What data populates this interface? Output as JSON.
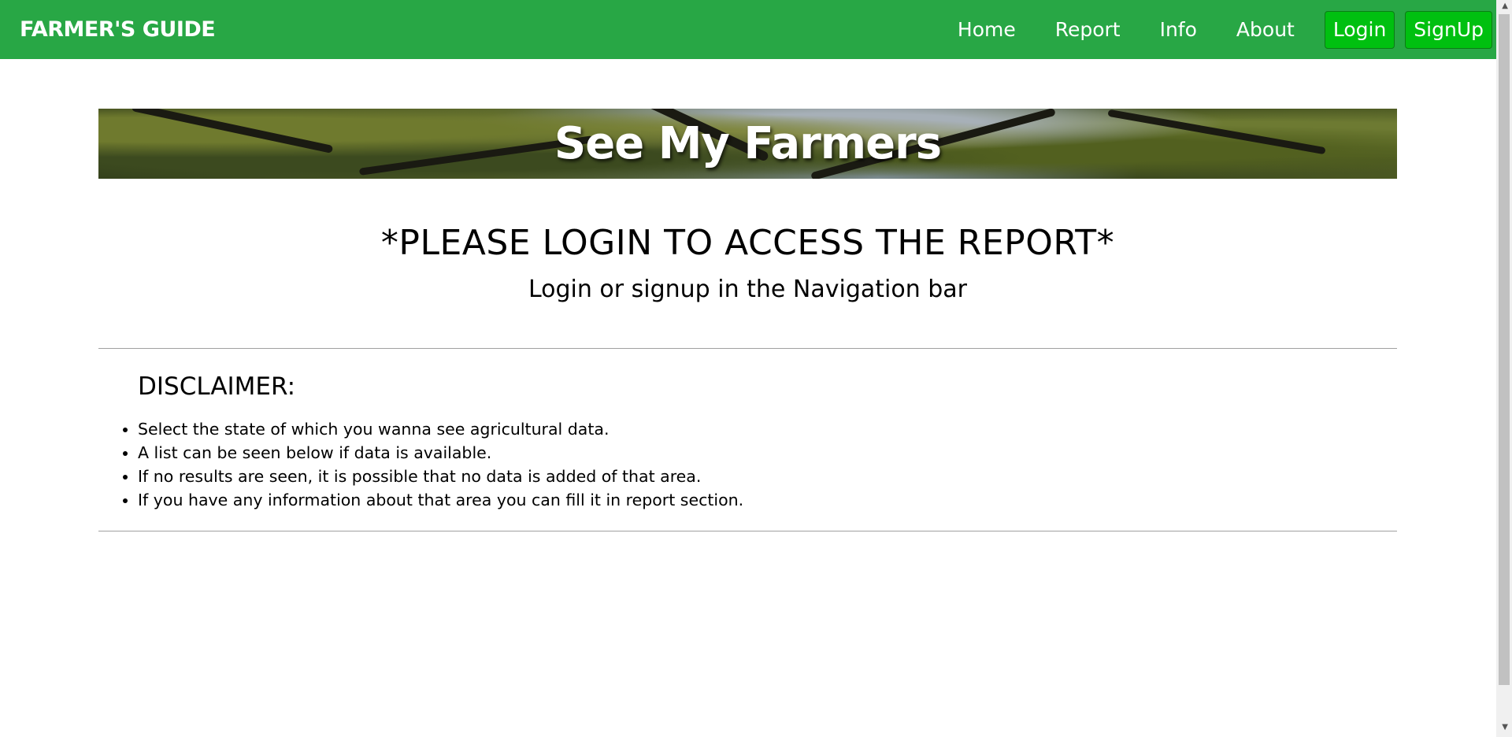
{
  "navbar": {
    "brand": "FARMER'S GUIDE",
    "links": [
      "Home",
      "Report",
      "Info",
      "About"
    ],
    "login_label": "Login",
    "signup_label": "SignUp",
    "background": "#28a745",
    "button_color": "#00c010"
  },
  "banner": {
    "title": "See My Farmers"
  },
  "main": {
    "login_heading": "*PLEASE LOGIN TO ACCESS THE REPORT*",
    "login_subheading": "Login or signup in the Navigation bar"
  },
  "disclaimer": {
    "title": "DISCLAIMER:",
    "items": [
      "Select the state of which you wanna see agricultural data.",
      "A list can be seen below if data is available.",
      "If no results are seen, it is possible that no data is added of that area.",
      "If you have any information about that area you can fill it in report section."
    ]
  }
}
